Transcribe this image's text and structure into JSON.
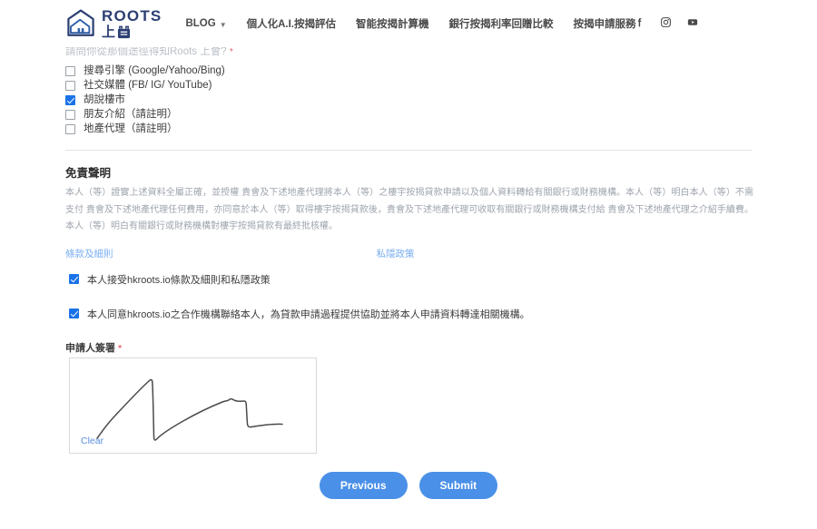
{
  "header": {
    "logo": {
      "name": "ROOTS",
      "cn": "上",
      "icon": "house-logo-icon",
      "color": "#2b3f73"
    },
    "nav": [
      {
        "label": "BLOG",
        "has_dropdown": true,
        "icon": "chevron-down-icon"
      },
      {
        "label": "個人化A.I.按揭評估",
        "has_dropdown": false
      },
      {
        "label": "智能按揭計算機",
        "has_dropdown": false
      },
      {
        "label": "銀行按揭利率回贈比較",
        "has_dropdown": false
      },
      {
        "label": "按揭申請服務",
        "has_dropdown": false
      }
    ],
    "social": [
      {
        "name": "facebook-icon",
        "label": "Facebook"
      },
      {
        "name": "instagram-icon",
        "label": "Instagram"
      },
      {
        "name": "youtube-icon",
        "label": "YouTube"
      }
    ]
  },
  "form": {
    "question_label": "請問你從那個途徑得知Roots 上會?",
    "required_mark": "*",
    "source_options": [
      {
        "label": "搜尋引擎 (Google/Yahoo/Bing)",
        "checked": false
      },
      {
        "label": "社交媒體 (FB/ IG/ YouTube)",
        "checked": false
      },
      {
        "label": "胡說樓市",
        "checked": true
      },
      {
        "label": "朋友介紹（請註明）",
        "checked": false
      },
      {
        "label": "地產代理（請註明）",
        "checked": false
      }
    ],
    "disclaimer": {
      "title": "免責聲明",
      "body": "本人（等）證實上述資料全屬正確，並授權 貴會及下述地產代理將本人（等）之樓宇按揭貸款申請以及個人資料轉給有關銀行或財務機構。本人（等）明白本人（等）不需支付 貴會及下述地產代理任何費用，亦同意於本人（等）取得樓宇按揭貸款後，貴會及下述地產代理可收取有關銀行或財務機構支付給 貴會及下述地產代理之介紹手續費。本人（等）明白有關銀行或財務機構對樓宇按揭貸款有最終批核權。"
    },
    "links": {
      "terms": "條款及細則",
      "privacy": "私隱政策"
    },
    "agreements": [
      {
        "label": "本人接受hkroots.io條款及細則和私隱政策",
        "checked": true
      },
      {
        "label": "本人同意hkroots.io之合作機構聯絡本人，為貸款申請過程提供協助並將本人申請資料轉達相關機構。",
        "checked": true
      }
    ],
    "signature": {
      "label": "申請人簽署",
      "required_mark": "*",
      "clear_label": "Clear"
    },
    "buttons": {
      "previous": "Previous",
      "submit": "Submit"
    }
  },
  "colors": {
    "accent_blue": "#4a90e8",
    "checkbox_blue": "#1a73e8",
    "link_blue": "#7aaef0",
    "logo_navy": "#2b3f73",
    "muted_text": "#9ea4ad"
  }
}
